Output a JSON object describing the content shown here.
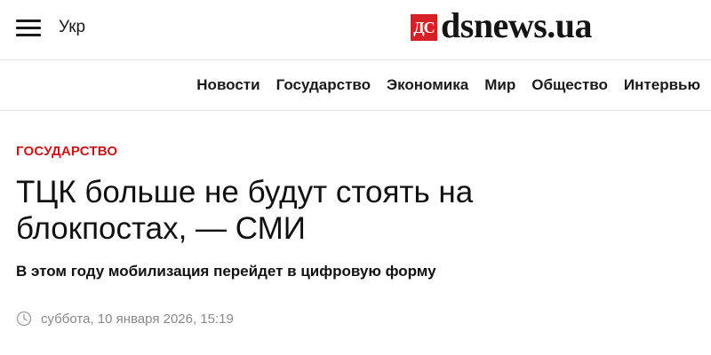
{
  "header": {
    "menu_icon": "hamburger-menu-icon",
    "language": "Укр",
    "logo_badge": "ДС",
    "logo_text": "dsnews.ua",
    "brand_color": "#d61f26"
  },
  "nav": {
    "items": [
      "Новости",
      "Государство",
      "Экономика",
      "Мир",
      "Общество",
      "Интервью"
    ]
  },
  "article": {
    "category": "ГОСУДАРСТВО",
    "category_color": "#c4161c",
    "headline_line1": "ТЦК больше не будут стоять на",
    "headline_line2": "блокпостах, — СМИ",
    "subtitle": "В этом году мобилизация перейдет в цифровую форму",
    "date_icon": "clock-icon",
    "date": "суббота, 10 января 2026, 15:19"
  }
}
